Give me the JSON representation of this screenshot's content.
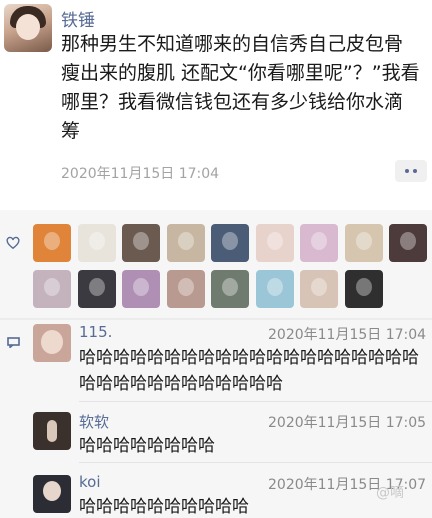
{
  "post": {
    "author": "铁锤",
    "text": "那种男生不知道哪来的自信秀自己皮包骨瘦出来的腹肌 还配文“你看哪里呢”？”我看哪里？我看微信钱包还有多少钱给你水滴筹",
    "timestamp": "2020年11月15日 17:04",
    "more_icon": "more-dots-icon"
  },
  "likes": {
    "icon": "heart-icon",
    "avatars": [
      {
        "name": "pumpkin-avatar",
        "color": "#e0843a"
      },
      {
        "name": "sketch-avatar",
        "color": "#e8e4dc"
      },
      {
        "name": "dark-photo-avatar",
        "color": "#6b5a50"
      },
      {
        "name": "anime-avatar",
        "color": "#c7b7a2"
      },
      {
        "name": "scene-avatar",
        "color": "#4b5c77"
      },
      {
        "name": "anime-girl-avatar",
        "color": "#e8d2cc"
      },
      {
        "name": "pink-avatar",
        "color": "#d9b9d0"
      },
      {
        "name": "plush-avatar",
        "color": "#d6c6b0"
      },
      {
        "name": "red-dark-avatar",
        "color": "#4d3a3a"
      },
      {
        "name": "girl-avatar-1",
        "color": "#c4b3bd"
      },
      {
        "name": "dark-avatar",
        "color": "#3a3a40"
      },
      {
        "name": "purple-avatar",
        "color": "#b08fb5"
      },
      {
        "name": "portrait-avatar",
        "color": "#b89a90"
      },
      {
        "name": "landscape-avatar",
        "color": "#6f7b6e"
      },
      {
        "name": "cartoon-avatar",
        "color": "#9ac6d8"
      },
      {
        "name": "selfie-avatar",
        "color": "#d8c4b6"
      },
      {
        "name": "bw-avatar",
        "color": "#2f2f2f"
      }
    ]
  },
  "comments_icon": "comment-icon",
  "comments": [
    {
      "name": "115.",
      "time": "2020年11月15日 17:04",
      "text": "哈哈哈哈哈哈哈哈哈哈哈哈哈哈哈哈哈哈哈哈哈哈哈哈哈哈哈哈哈哈哈哈",
      "avatar_color": "#caa69a"
    },
    {
      "name": "软软",
      "time": "2020年11月15日 17:05",
      "text": "哈哈哈哈哈哈哈哈",
      "avatar_color": "#3a302c"
    },
    {
      "name": "koi",
      "time": "2020年11月15日 17:07",
      "text": "哈哈哈哈哈哈哈哈哈哈",
      "avatar_color": "#2c2c34"
    }
  ],
  "watermark": "@嘀"
}
